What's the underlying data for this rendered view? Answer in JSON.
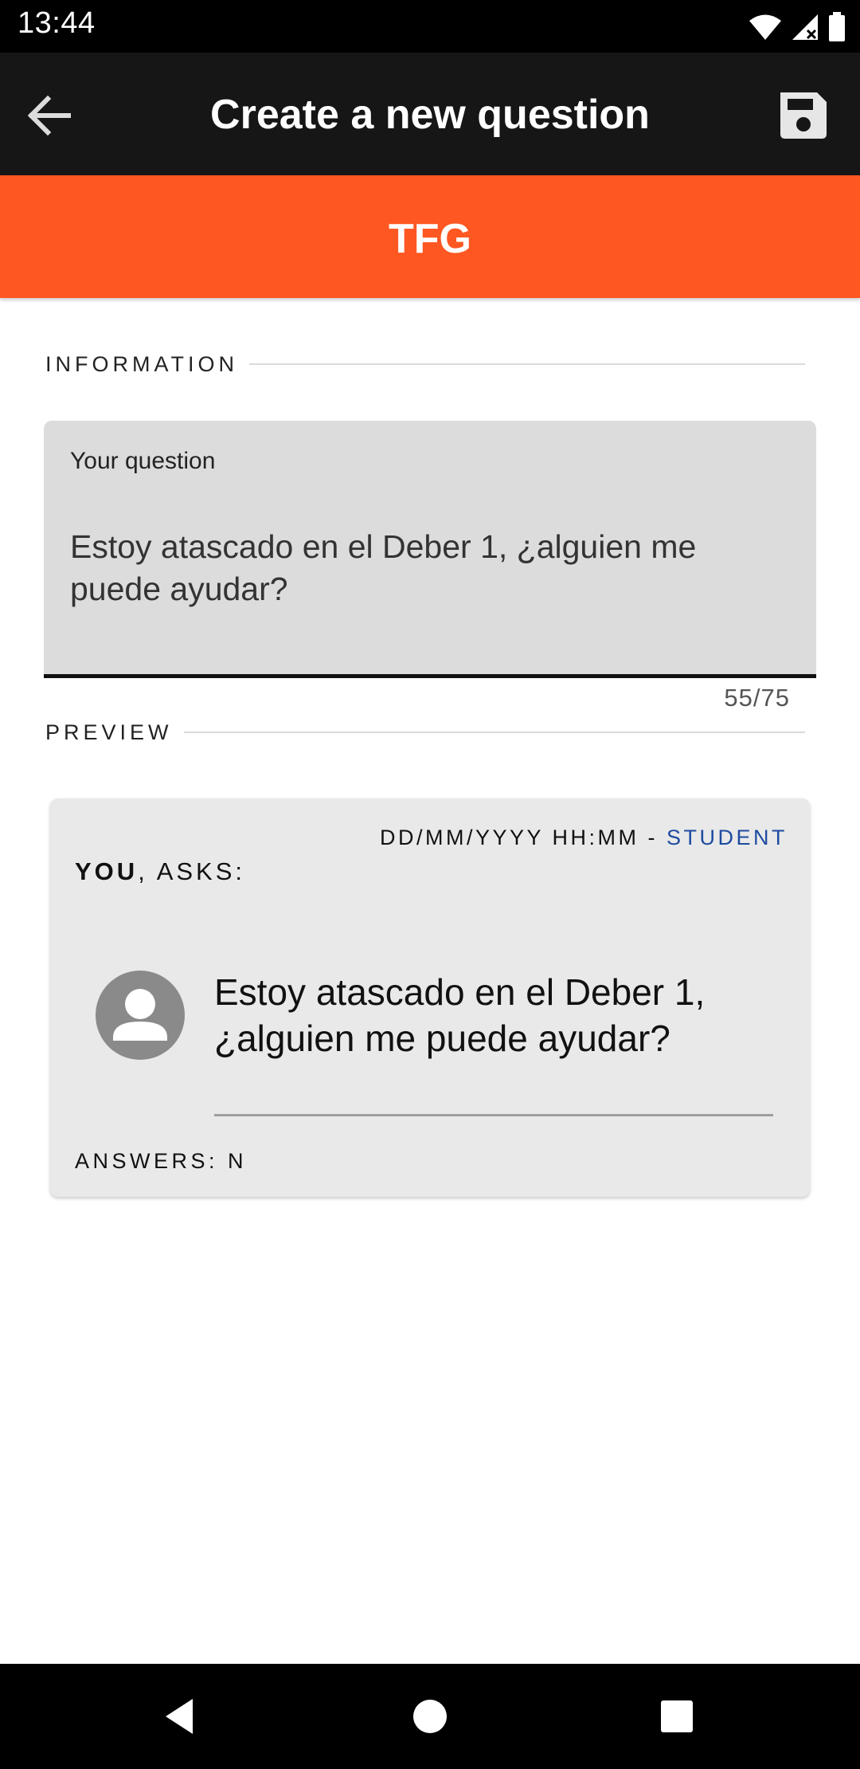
{
  "status_bar": {
    "time": "13:44",
    "icons": [
      "wifi-icon",
      "signal-icon",
      "battery-icon"
    ]
  },
  "app_bar": {
    "title": "Create a new question",
    "back_icon": "arrow-left-icon",
    "save_icon": "floppy-disk-icon"
  },
  "banner": {
    "title": "TFG",
    "color": "#ff5722"
  },
  "information_section": {
    "label": "INFORMATION"
  },
  "question_field": {
    "label": "Your question",
    "value": "Estoy atascado en el Deber 1, ¿alguien me puede ayudar?",
    "counter": "55/75"
  },
  "preview_section": {
    "label": "PREVIEW"
  },
  "preview_card": {
    "date_time": "DD/MM/YYYY HH:MM",
    "separator": " - ",
    "role": "STUDENT",
    "role_color": "#1e4ba0",
    "asker": "YOU",
    "asks_suffix": ", ASKS:",
    "avatar_icon": "person-avatar-icon",
    "question": "Estoy atascado en el Deber 1, ¿alguien me puede ayudar?",
    "answers": "ANSWERS: N"
  },
  "nav_bar": {
    "buttons": [
      "back-triangle-icon",
      "home-circle-icon",
      "recents-square-icon"
    ]
  }
}
